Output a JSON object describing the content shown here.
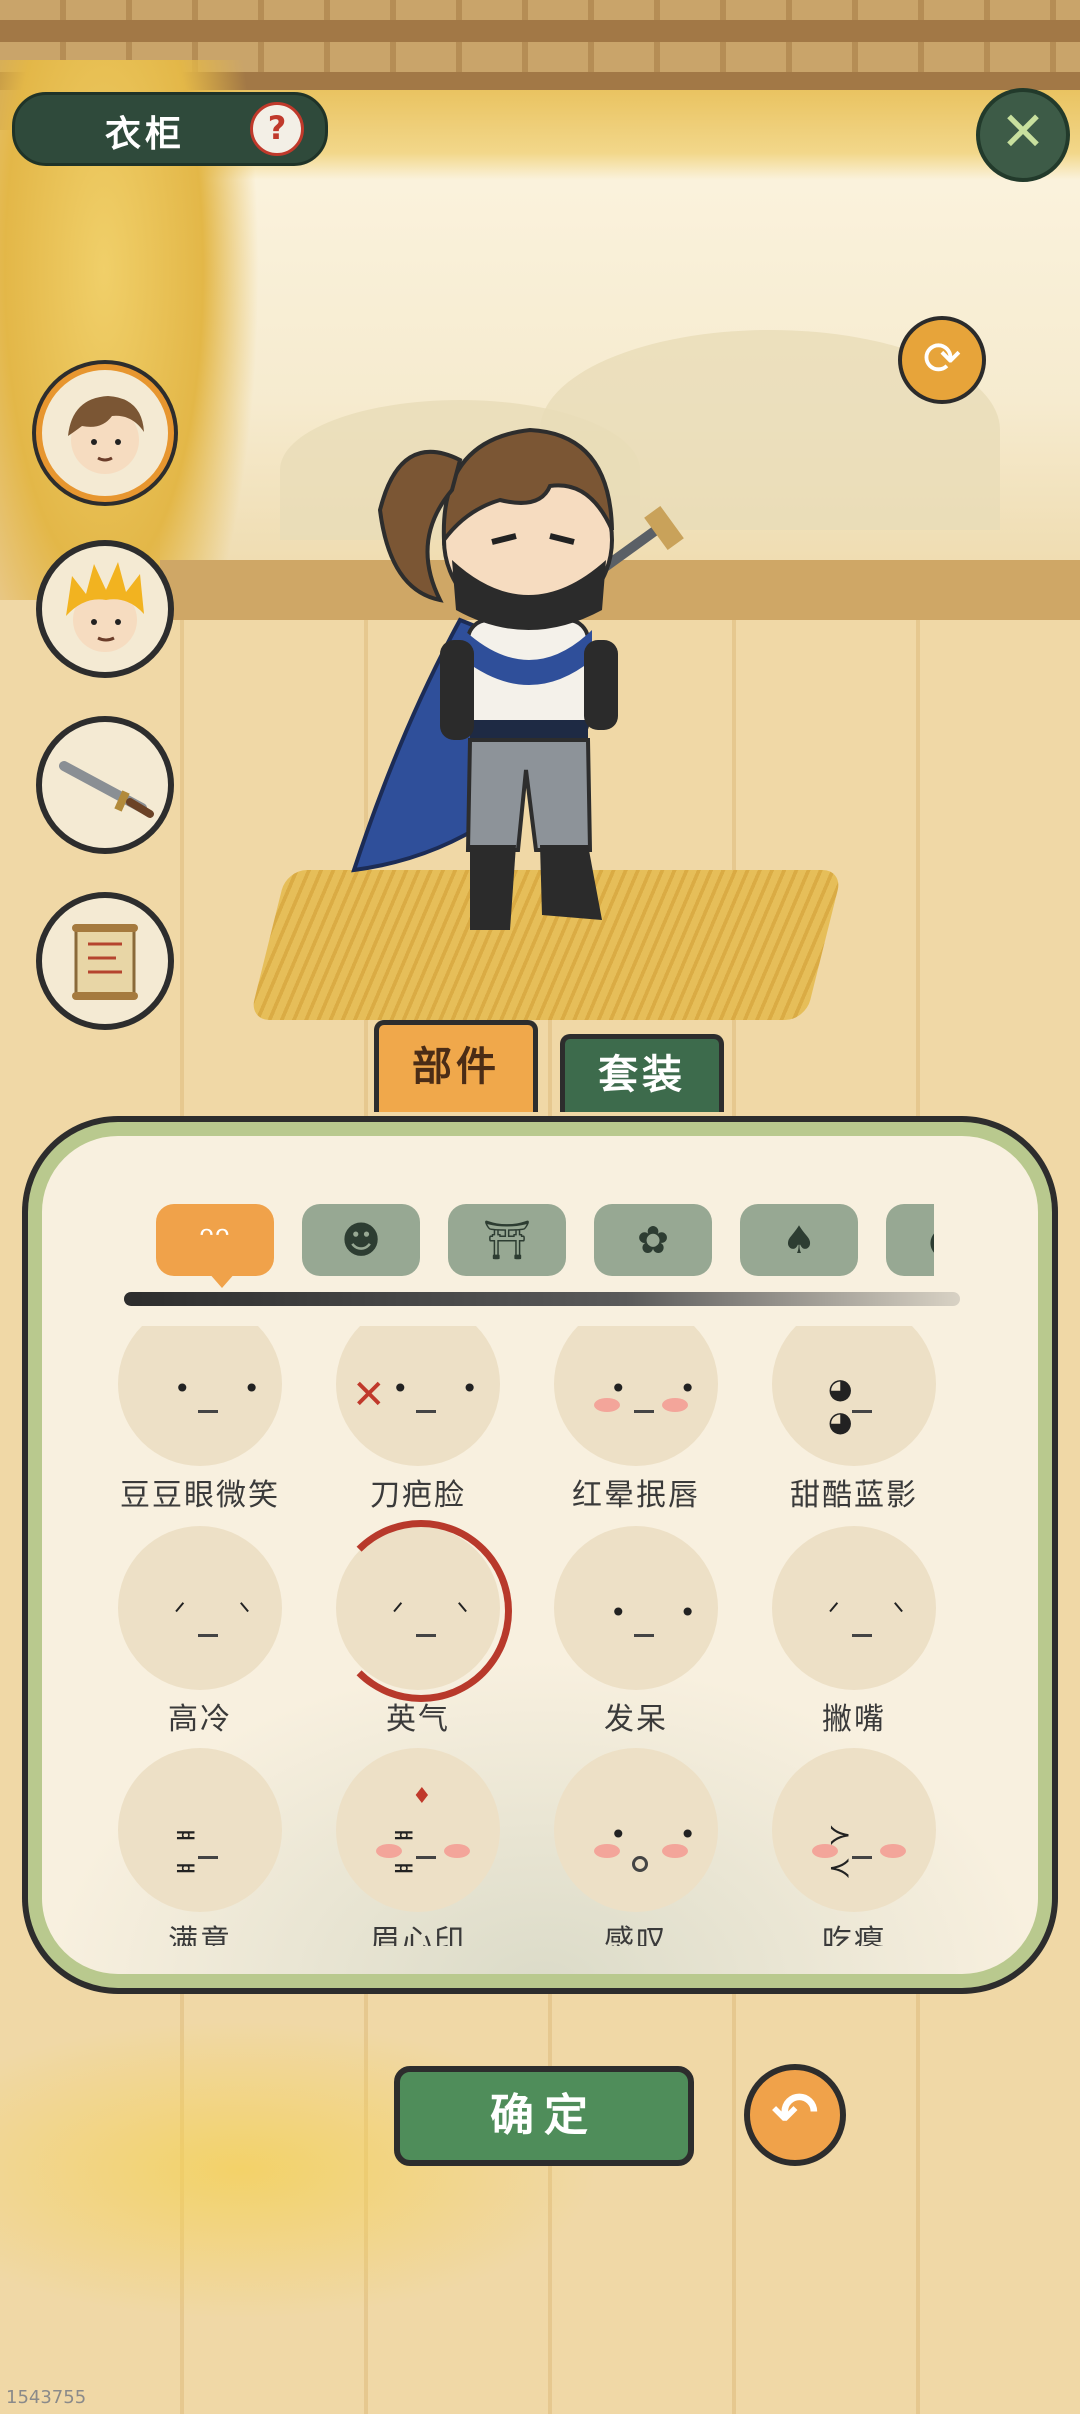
{
  "header": {
    "title": "衣柜",
    "help_symbol": "?",
    "close_symbol": "✕",
    "refresh_symbol": "⟳"
  },
  "side_slots": [
    {
      "name": "hair-slot",
      "icon": "hair-avatar-icon",
      "selected": true
    },
    {
      "name": "golden-hair-slot",
      "icon": "golden-hair-avatar-icon",
      "selected": false
    },
    {
      "name": "weapon-slot",
      "icon": "sword-icon",
      "selected": false
    },
    {
      "name": "scroll-slot",
      "icon": "scroll-icon",
      "selected": false
    }
  ],
  "tabs": {
    "parts_label": "部件",
    "sets_label": "套装"
  },
  "categories": [
    {
      "icon": "face-category-icon",
      "glyph": "ᵔᵔ",
      "active": true
    },
    {
      "icon": "hair-category-icon",
      "glyph": "☻",
      "active": false
    },
    {
      "icon": "clothes-category-icon",
      "glyph": "⛩",
      "active": false
    },
    {
      "icon": "flower-category-icon",
      "glyph": "✿",
      "active": false
    },
    {
      "icon": "hat-category-icon",
      "glyph": "♠",
      "active": false
    },
    {
      "icon": "more-category-icon",
      "glyph": "●",
      "active": false
    }
  ],
  "faces": [
    {
      "label": "豆豆眼微笑",
      "eyes": "• •",
      "blush": false,
      "selected": false
    },
    {
      "label": "刀疤脸",
      "eyes": "• •",
      "blush": false,
      "selected": false
    },
    {
      "label": "红晕抿唇",
      "eyes": "• •",
      "blush": true,
      "selected": false
    },
    {
      "label": "甜酷蓝影",
      "eyes": "◕ ◕",
      "blush": false,
      "selected": false
    },
    {
      "label": "高冷",
      "eyes": "ᐟ ᐠ",
      "blush": false,
      "selected": false
    },
    {
      "label": "英气",
      "eyes": "ᐟ ᐠ",
      "blush": false,
      "selected": true
    },
    {
      "label": "发呆",
      "eyes": "• •",
      "blush": false,
      "selected": false
    },
    {
      "label": "撇嘴",
      "eyes": "ᐟ ᐠ",
      "blush": false,
      "selected": false
    },
    {
      "label": "满意",
      "eyes": "≖ ≖",
      "blush": false,
      "selected": false
    },
    {
      "label": "眉心印",
      "eyes": "≖ ≖",
      "blush": true,
      "selected": false
    },
    {
      "label": "感叹",
      "eyes": "• •",
      "blush": true,
      "selected": false
    },
    {
      "label": "吃瘪",
      "eyes": "≻ ≺",
      "blush": true,
      "selected": false
    }
  ],
  "buttons": {
    "confirm_label": "确定",
    "undo_symbol": "↶"
  },
  "footer": {
    "corner_id": "1543755"
  },
  "colors": {
    "accent_orange": "#f0a24a",
    "panel_green": "#b9c98e",
    "dark_green": "#3d6b4c",
    "selected_ring": "#b8392b"
  }
}
